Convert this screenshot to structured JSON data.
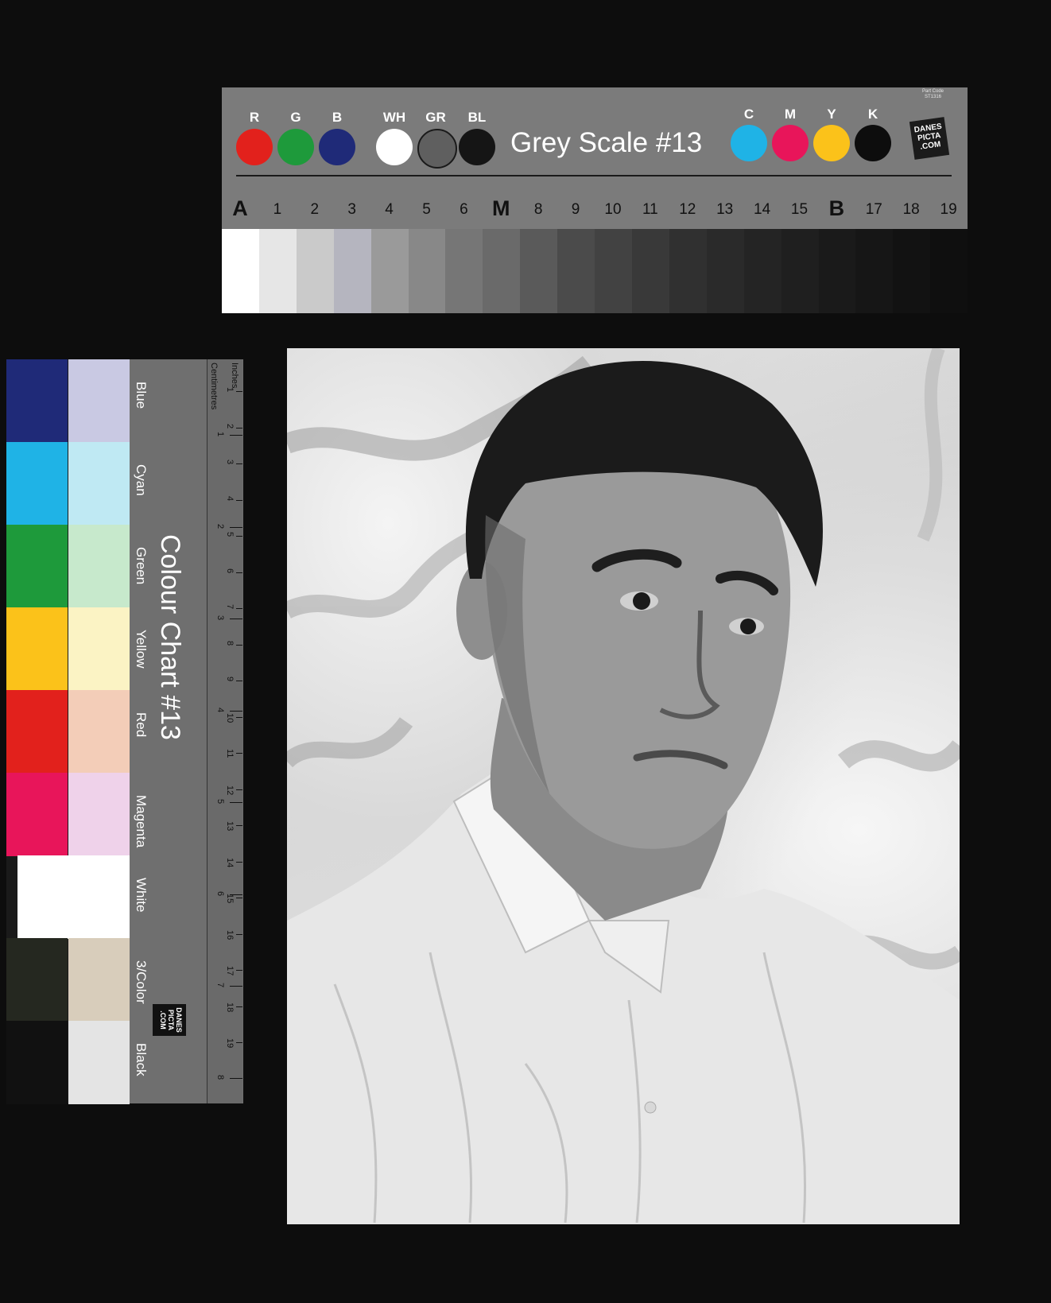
{
  "grey_scale_card": {
    "title": "Grey Scale #13",
    "part_code_label": "Part Code",
    "part_code": "ST1316",
    "logo_text": "DANES PICTA .COM",
    "rgb_swatches": [
      {
        "label": "R",
        "color": "#e2211c"
      },
      {
        "label": "G",
        "color": "#1e9a3b"
      },
      {
        "label": "B",
        "color": "#1f2a78"
      },
      {
        "label": "WH",
        "color": "#ffffff"
      },
      {
        "label": "GR",
        "color": "#5f5f5f"
      },
      {
        "label": "BL",
        "color": "#151515"
      }
    ],
    "cmyk_swatches": [
      {
        "label": "C",
        "color": "#1fb3e6"
      },
      {
        "label": "M",
        "color": "#e8155a"
      },
      {
        "label": "Y",
        "color": "#fbc21a"
      },
      {
        "label": "K",
        "color": "#0d0d0d"
      }
    ],
    "steps": [
      "A",
      "1",
      "2",
      "3",
      "4",
      "5",
      "6",
      "M",
      "8",
      "9",
      "10",
      "11",
      "12",
      "13",
      "14",
      "15",
      "B",
      "17",
      "18",
      "19"
    ],
    "step_tones": [
      "#ffffff",
      "#e6e6e6",
      "#cacaca",
      "#b5b5bf",
      "#9a9a9a",
      "#888888",
      "#767676",
      "#6a6a6a",
      "#5a5a5a",
      "#4b4b4b",
      "#424242",
      "#393939",
      "#303030",
      "#2a2a2a",
      "#242424",
      "#1f1f1f",
      "#1a1a1a",
      "#161616",
      "#121212",
      "#0f0f0f"
    ]
  },
  "colour_chart_card": {
    "title": "Colour Chart #13",
    "logo_text": "DANES PICTA .COM",
    "ruler_labels": {
      "centimetres": "Centimetres",
      "inches": "Inches"
    },
    "rows": [
      {
        "name": "Blue",
        "dark": "#1f2a78",
        "light": "#c9c9e3"
      },
      {
        "name": "Cyan",
        "dark": "#1fb3e6",
        "light": "#bfe9f3"
      },
      {
        "name": "Green",
        "dark": "#1e9a3b",
        "light": "#c7e9cc"
      },
      {
        "name": "Yellow",
        "dark": "#fbc21a",
        "light": "#fbf3c4"
      },
      {
        "name": "Red",
        "dark": "#e2211c",
        "light": "#f3cdb8"
      },
      {
        "name": "Magenta",
        "dark": "#e8155a",
        "light": "#efd2ea"
      },
      {
        "name": "White",
        "dark": "#ffffff",
        "light": "#ffffff"
      },
      {
        "name": "3/Color",
        "dark": "#252820",
        "light": "#d8cdbb"
      },
      {
        "name": "Black",
        "dark": "#111111",
        "light": "#e4e4e4"
      }
    ],
    "cm_marks": [
      "1",
      "2",
      "3",
      "4",
      "5",
      "6",
      "7",
      "8",
      "9",
      "10",
      "11",
      "12",
      "13",
      "14",
      "15",
      "16",
      "17",
      "18",
      "19"
    ],
    "inch_marks": [
      "1",
      "2",
      "3",
      "4",
      "5",
      "6",
      "7",
      "8"
    ]
  },
  "photograph": {
    "subject": "black-and-white portrait of a man in a white collared shirt"
  }
}
